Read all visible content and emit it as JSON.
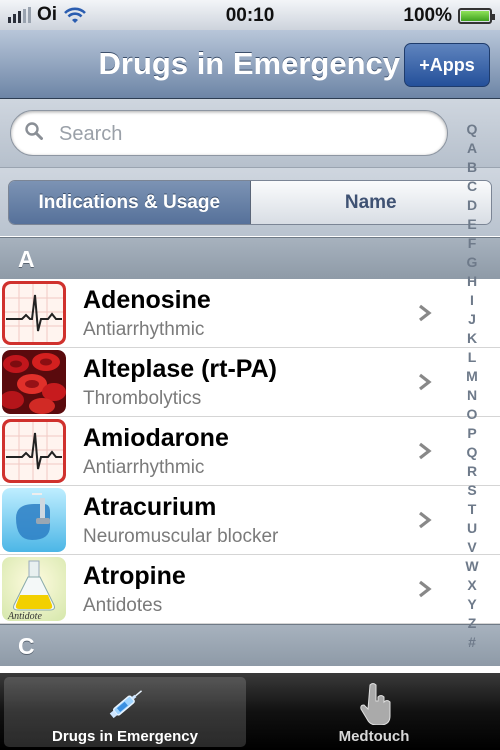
{
  "status": {
    "carrier": "Oi",
    "time": "00:10",
    "battery": "100%"
  },
  "nav": {
    "title": "Drugs in Emergency",
    "apps_button": "+Apps"
  },
  "search": {
    "placeholder": "Search"
  },
  "segments": [
    "Indications & Usage",
    "Name"
  ],
  "sections": [
    {
      "letter": "A",
      "items": [
        {
          "name": "Adenosine",
          "category": "Antiarrhythmic",
          "icon": "ecg-icon"
        },
        {
          "name": "Alteplase (rt-PA)",
          "category": "Thrombolytics",
          "icon": "blood-cells-icon"
        },
        {
          "name": "Amiodarone",
          "category": "Antiarrhythmic",
          "icon": "ecg-icon"
        },
        {
          "name": "Atracurium",
          "category": "Neuromuscular blocker",
          "icon": "ventilation-mask-icon"
        },
        {
          "name": "Atropine",
          "category": "Antidotes",
          "icon": "antidote-flask-icon",
          "icon_text": "Antidote"
        }
      ]
    },
    {
      "letter": "C",
      "items": []
    }
  ],
  "index": [
    "Q",
    "A",
    "B",
    "C",
    "D",
    "E",
    "F",
    "G",
    "H",
    "I",
    "J",
    "K",
    "L",
    "M",
    "N",
    "O",
    "P",
    "Q",
    "R",
    "S",
    "T",
    "U",
    "V",
    "W",
    "X",
    "Y",
    "Z",
    "#"
  ],
  "tabs": [
    {
      "label": "Drugs in Emergency",
      "icon": "syringe-icon",
      "selected": true
    },
    {
      "label": "Medtouch",
      "icon": "hand-pointer-icon",
      "selected": false
    }
  ],
  "colors": {
    "nav_blue": "#6d85a6",
    "segment_active": "#56719a",
    "ecg_red": "#d0312d"
  }
}
